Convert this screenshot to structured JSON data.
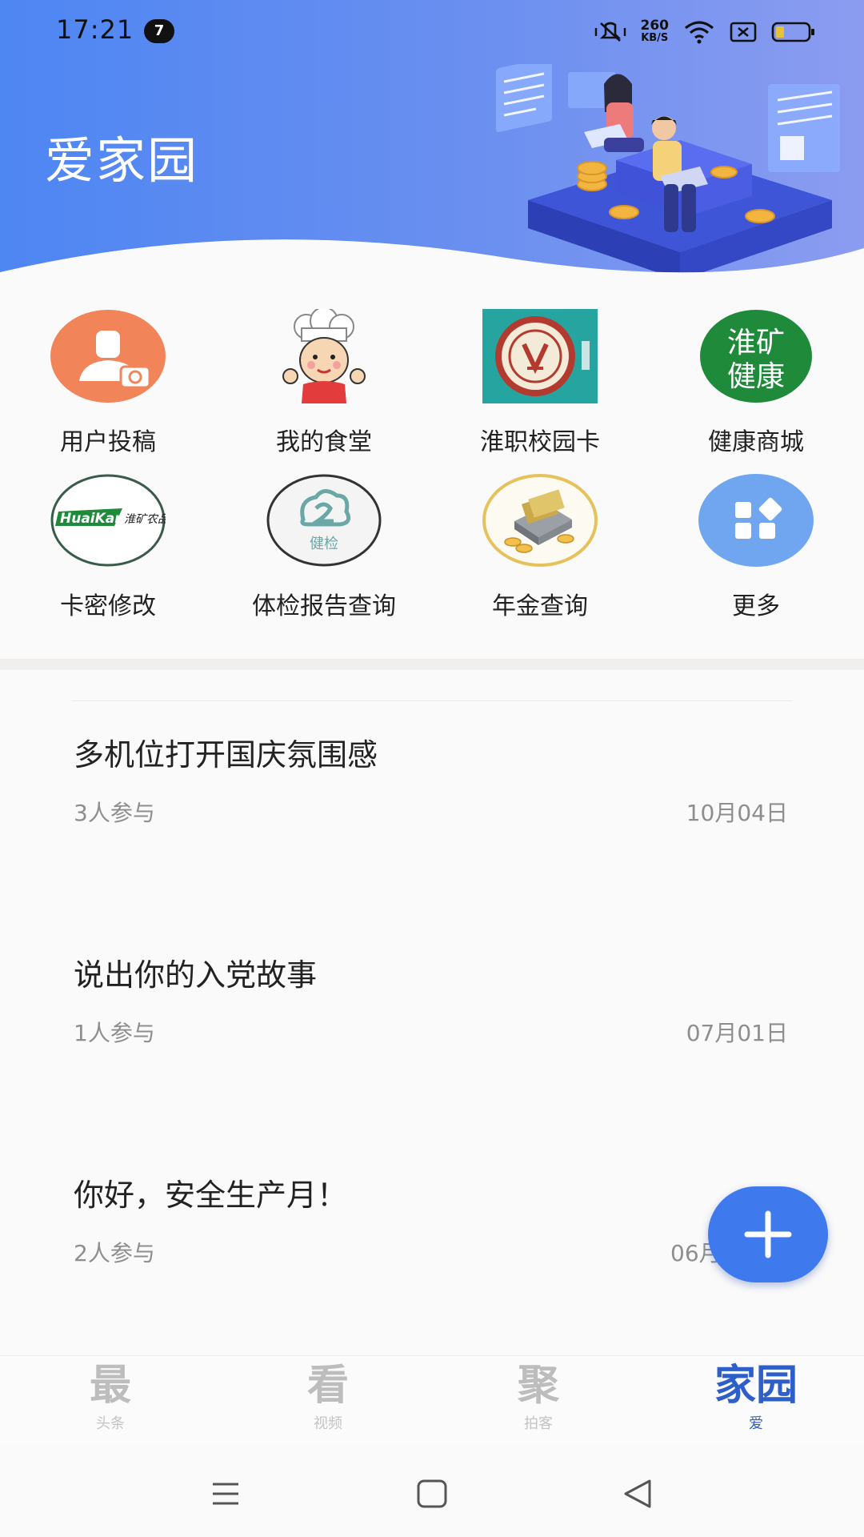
{
  "status": {
    "time": "17:21",
    "notification_count": "7",
    "net_speed_value": "260",
    "net_speed_unit": "KB/S"
  },
  "header": {
    "title": "爱家园"
  },
  "grid": {
    "items": [
      {
        "label": "用户投稿",
        "icon": "user-camera-icon"
      },
      {
        "label": "我的食堂",
        "icon": "chef-icon"
      },
      {
        "label": "淮职校园卡",
        "icon": "campus-card-logo"
      },
      {
        "label": "健康商城",
        "icon": "health-mall-logo"
      },
      {
        "label": "卡密修改",
        "icon": "huaikuang-agri-logo"
      },
      {
        "label": "体检报告查询",
        "icon": "health-check-icon"
      },
      {
        "label": "年金查询",
        "icon": "money-icon"
      },
      {
        "label": "更多",
        "icon": "more-grid-icon"
      }
    ],
    "logo_text": {
      "health_mall": [
        "淮矿",
        "健康"
      ],
      "huaikuang_brand": "HuaiKan",
      "huaikuang_sub": "淮矿农品",
      "health_check": "健检"
    }
  },
  "topics": [
    {
      "title": "多机位打开国庆氛围感",
      "participants": "3人参与",
      "date": "10月04日"
    },
    {
      "title": "说出你的入党故事",
      "participants": "1人参与",
      "date": "07月01日"
    },
    {
      "title": "你好，安全生产月！",
      "participants": "2人参与",
      "date": "06月"
    }
  ],
  "tabbar": {
    "tabs": [
      {
        "main": "最",
        "sub": "头条"
      },
      {
        "main": "看",
        "sub": "视频"
      },
      {
        "main": "聚",
        "sub": "拍客"
      },
      {
        "main": "家园",
        "sub": "爱"
      }
    ],
    "active_index": 3
  },
  "colors": {
    "header_start": "#4e86f2",
    "header_end": "#8b9cf0",
    "accent": "#3f79ee",
    "active_tab": "#2e5fc9"
  }
}
